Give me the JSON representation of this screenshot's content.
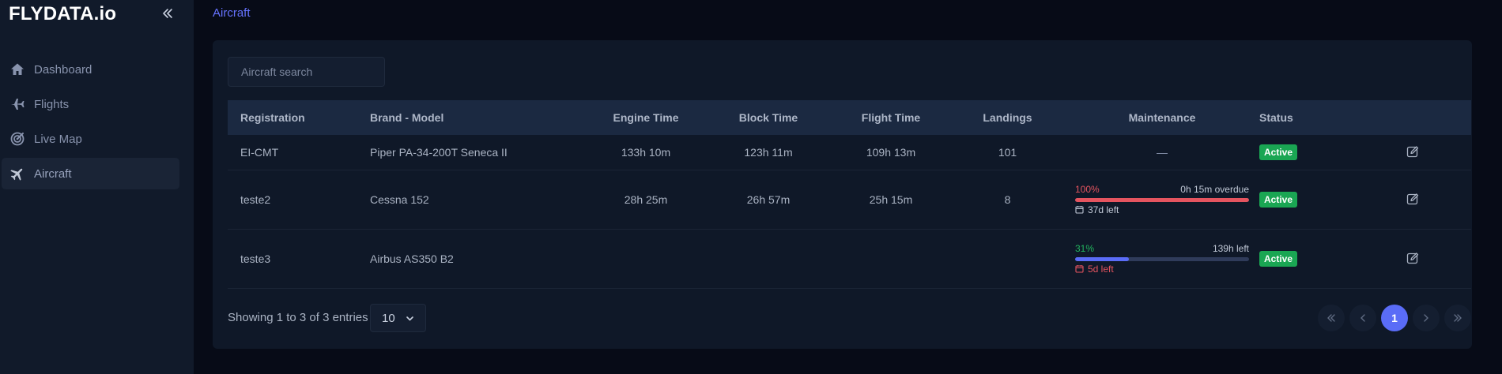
{
  "app": {
    "brand": "FLYDATA.io"
  },
  "sidebar": {
    "items": [
      {
        "label": "Dashboard",
        "icon": "home-icon"
      },
      {
        "label": "Flights",
        "icon": "plane-icon"
      },
      {
        "label": "Live Map",
        "icon": "radar-icon"
      },
      {
        "label": "Aircraft",
        "icon": "aircraft-icon",
        "active": true
      }
    ]
  },
  "breadcrumb": {
    "current": "Aircraft"
  },
  "search": {
    "placeholder": "Aircraft search",
    "value": ""
  },
  "table": {
    "columns": [
      "Registration",
      "Brand - Model",
      "Engine Time",
      "Block Time",
      "Flight Time",
      "Landings",
      "Maintenance",
      "Status"
    ],
    "rows": [
      {
        "registration": "EI-CMT",
        "model": "Piper PA-34-200T Seneca II",
        "engine_time": "133h 10m",
        "block_time": "123h 11m",
        "flight_time": "109h 13m",
        "landings": "101",
        "maintenance_text": "—",
        "status": "Active"
      },
      {
        "registration": "teste2",
        "model": "Cessna 152",
        "engine_time": "28h 25m",
        "block_time": "26h 57m",
        "flight_time": "25h 15m",
        "landings": "8",
        "maintenance": {
          "percent_label": "100%",
          "percent": 100,
          "right": "0h 15m overdue",
          "days": "37d left",
          "bar_color": "#e5545f",
          "pct_color": "#e5545f",
          "days_color": "#c0c8d6"
        },
        "status": "Active"
      },
      {
        "registration": "teste3",
        "model": "Airbus AS350 B2",
        "engine_time": "",
        "block_time": "",
        "flight_time": "",
        "landings": "",
        "maintenance": {
          "percent_label": "31%",
          "percent": 31,
          "right": "139h left",
          "days": "5d left",
          "bar_color": "#5a6cf7",
          "pct_color": "#22b35e",
          "days_color": "#e5545f"
        },
        "status": "Active"
      }
    ]
  },
  "footer": {
    "entries_text": "Showing 1 to 3 of 3 entries",
    "page_size": "10",
    "current_page": "1"
  },
  "colors": {
    "accent": "#5a6cf7",
    "active_badge": "#1aa653",
    "danger": "#e5545f",
    "success": "#22b35e"
  }
}
